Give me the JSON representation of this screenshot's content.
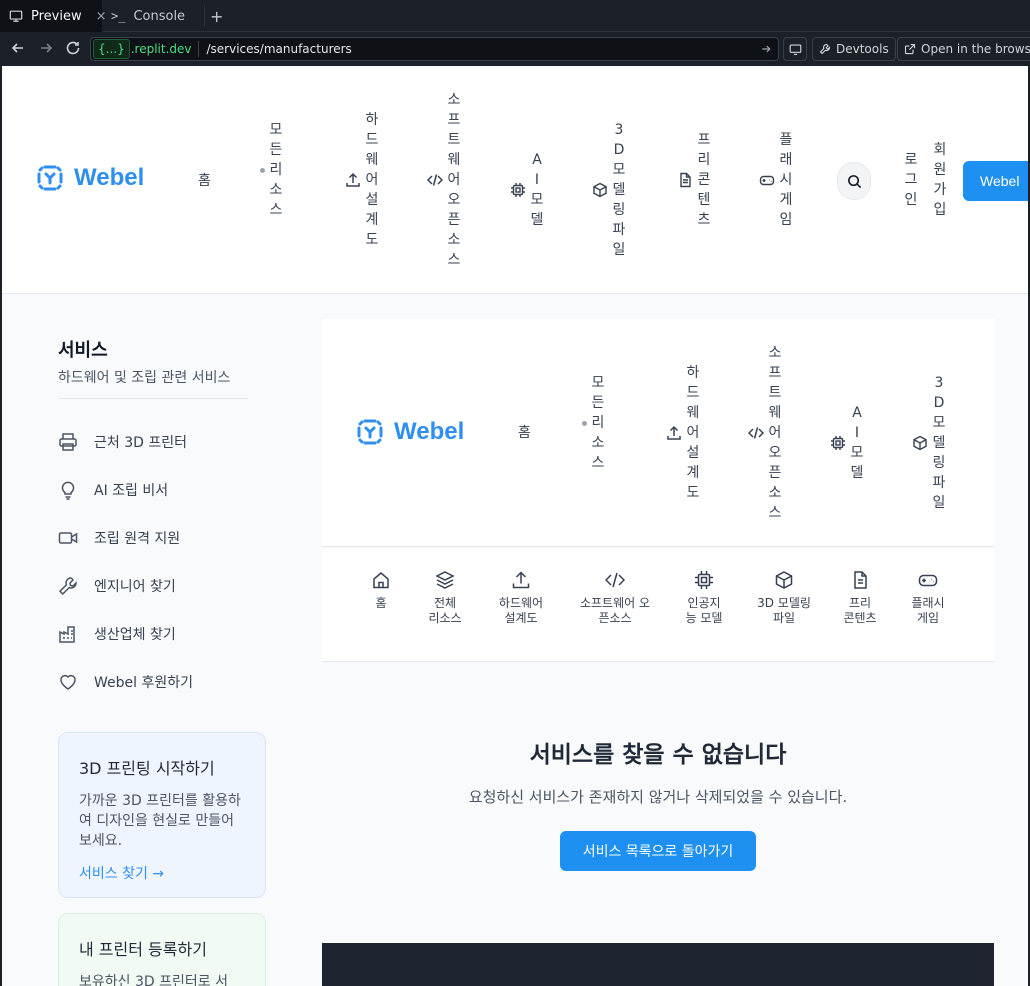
{
  "ide": {
    "tabs": [
      {
        "label": "Preview",
        "icon": "monitor-icon"
      },
      {
        "label": "Console",
        "icon": "terminal-icon"
      }
    ],
    "close_glyph": "×",
    "add_tab_glyph": "+",
    "url_domain_chip": "{...}",
    "url_domain_rest": ".replit.dev",
    "url_path": "/services/manufacturers",
    "devtools_label": "Devtools",
    "open_browser_label": "Open in the browser"
  },
  "site": {
    "brand": "Webel",
    "nav": [
      {
        "label": "홈",
        "icon": ""
      },
      {
        "label": "모든 리소스",
        "icon": "dot-icon"
      },
      {
        "label": "하드웨어설계도",
        "icon": "upload-icon"
      },
      {
        "label": "소프트웨어오픈소스",
        "icon": "code-icon"
      },
      {
        "label": "AI 모델",
        "icon": "chip-icon"
      },
      {
        "label": "3D 모델링파일",
        "icon": "cube-icon"
      },
      {
        "label": "프리콘텐츠",
        "icon": "file-icon"
      },
      {
        "label": "플래시게임",
        "icon": "gamepad-icon"
      }
    ],
    "login_label": "로그인",
    "signup_label": "회원가입",
    "cta_label": "Webel"
  },
  "sidebar": {
    "title": "서비스",
    "subtitle": "하드웨어 및 조립 관련 서비스",
    "items": [
      {
        "label": "근처 3D 프린터",
        "icon": "printer-icon"
      },
      {
        "label": "AI 조립 비서",
        "icon": "lightbulb-icon"
      },
      {
        "label": "조립 원격 지원",
        "icon": "video-icon"
      },
      {
        "label": "엔지니어 찾기",
        "icon": "wrench-icon"
      },
      {
        "label": "생산업체 찾기",
        "icon": "factory-icon"
      },
      {
        "label": "Webel 후원하기",
        "icon": "heart-icon"
      }
    ],
    "card_print": {
      "title": "3D 프린팅 시작하기",
      "text": "가까운 3D 프린터를 활용하여 디자인을 현실로 만들어보세요.",
      "link": "서비스 찾기 →"
    },
    "card_register": {
      "title": "내 프린터 등록하기",
      "text": "보유하신 3D 프린터로 서"
    }
  },
  "inner": {
    "nav": [
      {
        "label": "홈"
      },
      {
        "label": "모든 리소스"
      },
      {
        "label": "하드웨어설계도"
      },
      {
        "label": "소프트웨어오픈소스"
      },
      {
        "label": "AI 모델"
      },
      {
        "label": "3D 모델링파일"
      }
    ],
    "subnav": [
      {
        "label": "홈",
        "icon": "home-icon"
      },
      {
        "label": "전체 리소스",
        "icon": "layers-icon"
      },
      {
        "label": "하드웨어 설계도",
        "icon": "upload-icon"
      },
      {
        "label": "소프트웨어 오픈소스",
        "icon": "code-icon"
      },
      {
        "label": "인공지능 모델",
        "icon": "chip-icon"
      },
      {
        "label": "3D 모델링 파일",
        "icon": "cube-icon"
      },
      {
        "label": "프리 콘텐츠",
        "icon": "file-icon"
      },
      {
        "label": "플래시 게임",
        "icon": "gamepad-icon"
      }
    ]
  },
  "notfound": {
    "title": "서비스를 찾을 수 없습니다",
    "message": "요청하신 서비스가 존재하지 않거나 삭제되었을 수 있습니다.",
    "back_button": "서비스 목록으로 돌아가기"
  },
  "colors": {
    "brand_blue": "#1e90f2",
    "ide_bg": "#1c2128",
    "domain_green": "#4ade80",
    "footer_dark": "#1f2530"
  }
}
